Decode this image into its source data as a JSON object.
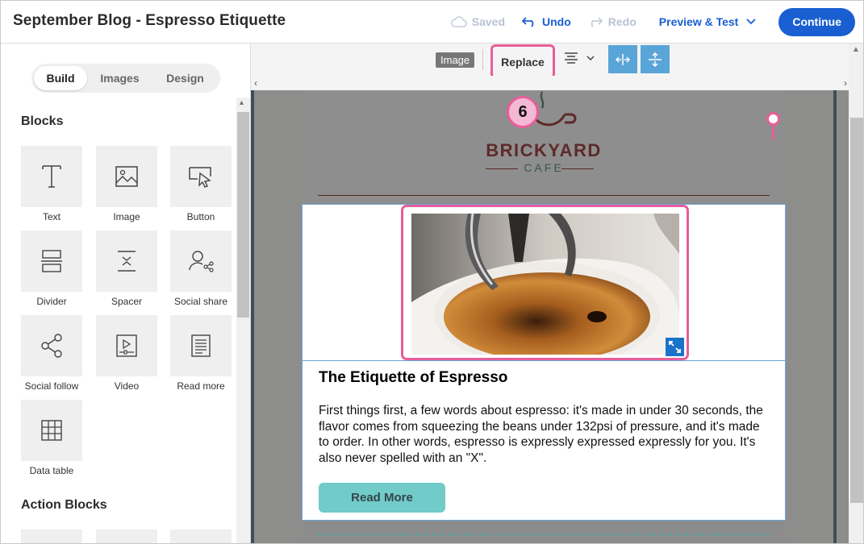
{
  "header": {
    "title": "September Blog - Espresso Etiquette",
    "saved": "Saved",
    "undo": "Undo",
    "redo": "Redo",
    "preview": "Preview & Test",
    "continue": "Continue"
  },
  "sidebar": {
    "tabs": [
      "Build",
      "Images",
      "Design"
    ],
    "blocks_heading": "Blocks",
    "blocks": [
      {
        "label": "Text",
        "icon": "text-icon"
      },
      {
        "label": "Image",
        "icon": "image-icon"
      },
      {
        "label": "Button",
        "icon": "button-icon"
      },
      {
        "label": "Divider",
        "icon": "divider-icon"
      },
      {
        "label": "Spacer",
        "icon": "spacer-icon"
      },
      {
        "label": "Social share",
        "icon": "social-share-icon"
      },
      {
        "label": "Social follow",
        "icon": "social-follow-icon"
      },
      {
        "label": "Video",
        "icon": "video-icon"
      },
      {
        "label": "Read more",
        "icon": "read-more-icon"
      },
      {
        "label": "Data table",
        "icon": "data-table-icon"
      }
    ],
    "action_heading": "Action Blocks"
  },
  "toolbar": {
    "image_label": "Image",
    "replace": "Replace"
  },
  "email": {
    "logo_title": "BRICKYARD",
    "logo_sub": "CAFE",
    "article_title": "The Etiquette of Espresso",
    "article_body": "First things first, a few words about espresso: it's made in under 30 seconds, the flavor comes from squeezing the beans under 132psi of pressure, and it's made to order. In other words, espresso is expressly expressed expressly for you. It's also never spelled with an \"X\".",
    "read_more": "Read More"
  },
  "callout": {
    "number": "6"
  },
  "colors": {
    "accent": "#1a5fd1",
    "highlight": "#e85d9a",
    "button_teal": "#70cbc9"
  }
}
